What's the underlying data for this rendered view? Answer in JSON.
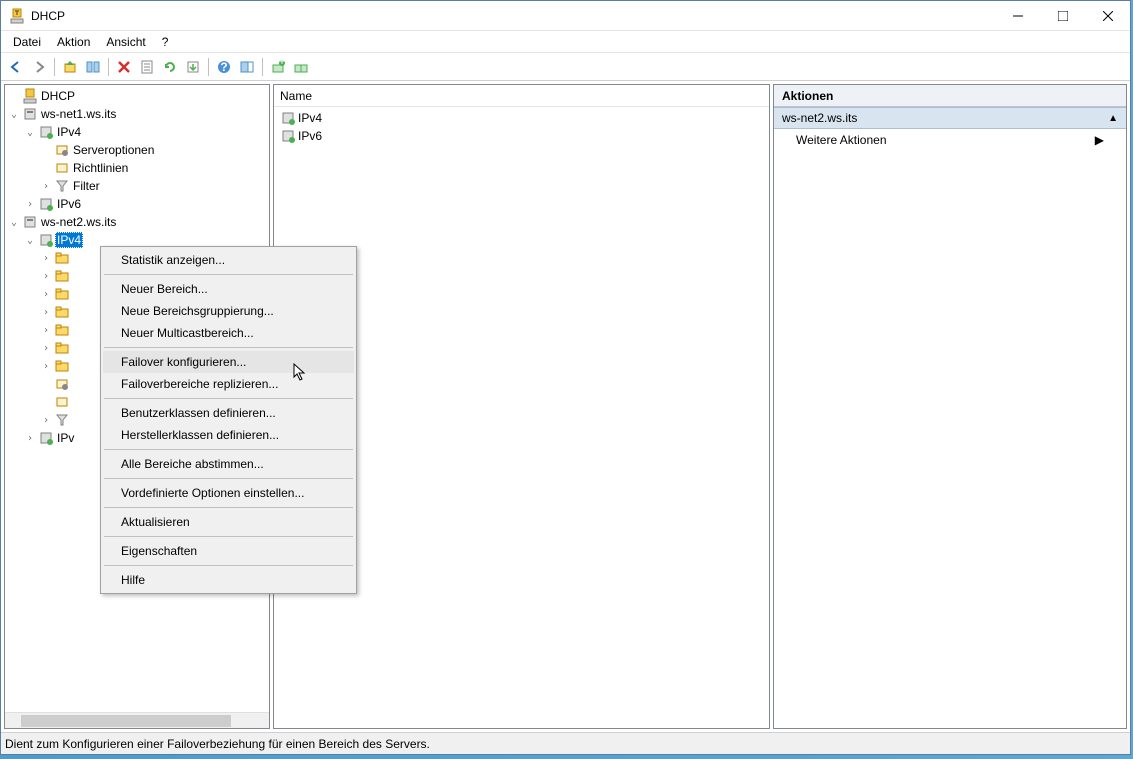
{
  "title": "DHCP",
  "menubar": [
    "Datei",
    "Aktion",
    "Ansicht",
    "?"
  ],
  "tree": {
    "root": "DHCP",
    "server1": "ws-net1.ws.its",
    "server1_ipv4": "IPv4",
    "server1_serveroptionen": "Serveroptionen",
    "server1_richtlinien": "Richtlinien",
    "server1_filter": "Filter",
    "server1_ipv6": "IPv6",
    "server2": "ws-net2.ws.its",
    "server2_ipv4": "IPv4",
    "server2_ipv6": "IPv"
  },
  "list": {
    "header": "Name",
    "items": [
      "IPv4",
      "IPv6"
    ]
  },
  "actions": {
    "title": "Aktionen",
    "section": "ws-net2.ws.its",
    "more": "Weitere Aktionen"
  },
  "context_menu": [
    "Statistik anzeigen...",
    "Neuer Bereich...",
    "Neue Bereichsgruppierung...",
    "Neuer Multicastbereich...",
    "Failover konfigurieren...",
    "Failoverbereiche replizieren...",
    "Benutzerklassen definieren...",
    "Herstellerklassen definieren...",
    "Alle Bereiche abstimmen...",
    "Vordefinierte Optionen einstellen...",
    "Aktualisieren",
    "Eigenschaften",
    "Hilfe"
  ],
  "statusbar": "Dient zum Konfigurieren einer Failoverbeziehung für einen Bereich des Servers."
}
